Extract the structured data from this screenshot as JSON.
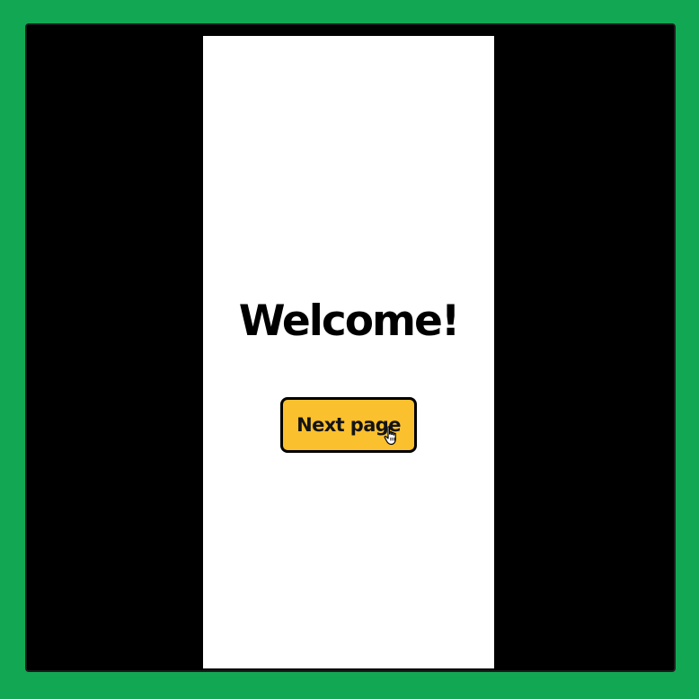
{
  "page": {
    "title": "Welcome!",
    "next_button_label": "Next page"
  },
  "colors": {
    "outer_background": "#12a853",
    "frame_background": "#000000",
    "screen_background": "#ffffff",
    "button_background": "#fbc02d",
    "button_border": "#000000"
  },
  "icons": {
    "cursor": "hand-pointer-icon"
  }
}
